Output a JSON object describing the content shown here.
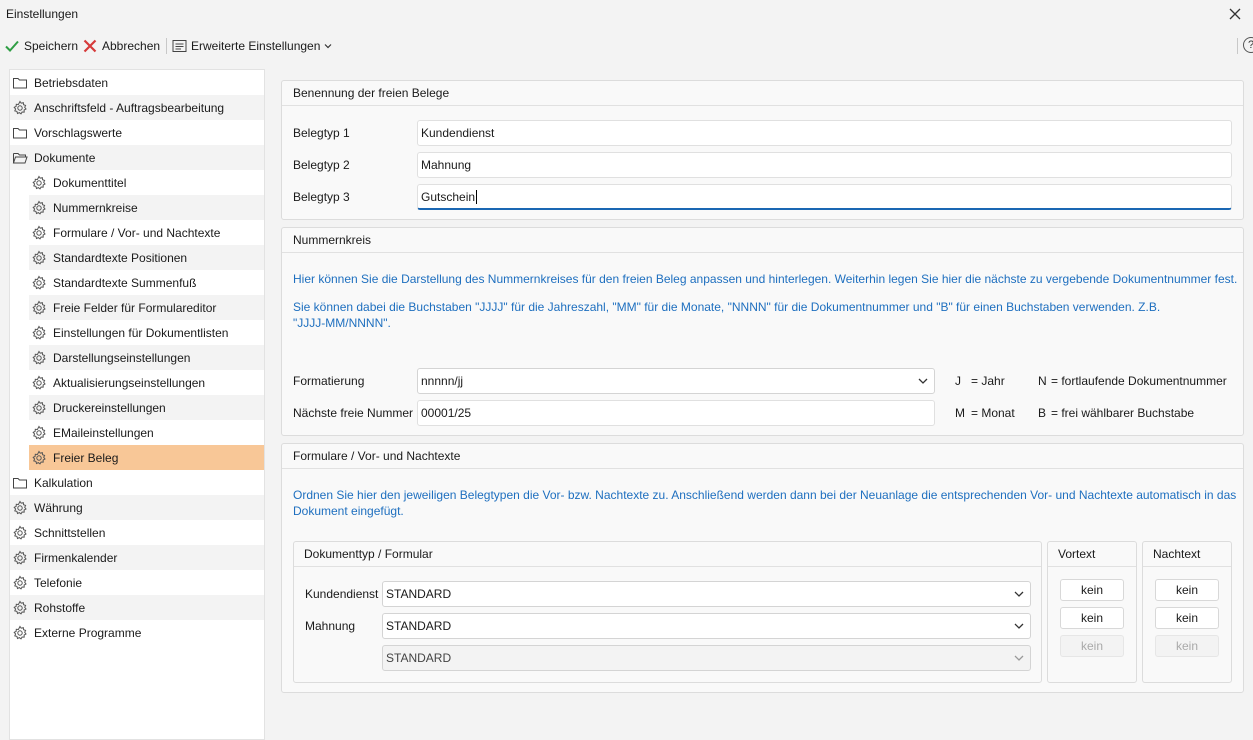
{
  "window": {
    "title": "Einstellungen"
  },
  "toolbar": {
    "save_label": "Speichern",
    "cancel_label": "Abbrechen",
    "advanced_label": "Erweiterte Einstellungen",
    "help_glyph": "?"
  },
  "sidebar": {
    "items": [
      {
        "label": "Betriebsdaten",
        "icon": "folder-icon"
      },
      {
        "label": "Anschriftsfeld - Auftragsbearbeitung",
        "icon": "gear-icon"
      },
      {
        "label": "Vorschlagswerte",
        "icon": "folder-icon"
      },
      {
        "label": "Dokumente",
        "icon": "folder-open-icon"
      },
      {
        "label": "Dokumenttitel",
        "icon": "gear-icon"
      },
      {
        "label": "Nummernkreise",
        "icon": "gear-icon"
      },
      {
        "label": "Formulare / Vor- und Nachtexte",
        "icon": "gear-icon"
      },
      {
        "label": "Standardtexte Positionen",
        "icon": "gear-icon"
      },
      {
        "label": "Standardtexte Summenfuß",
        "icon": "gear-icon"
      },
      {
        "label": "Freie Felder für Formulareditor",
        "icon": "gear-icon"
      },
      {
        "label": "Einstellungen für Dokumentlisten",
        "icon": "gear-icon"
      },
      {
        "label": "Darstellungseinstellungen",
        "icon": "gear-icon"
      },
      {
        "label": "Aktualisierungseinstellungen",
        "icon": "gear-icon"
      },
      {
        "label": "Druckereinstellungen",
        "icon": "gear-icon"
      },
      {
        "label": "EMaileinstellungen",
        "icon": "gear-icon"
      },
      {
        "label": "Freier Beleg",
        "icon": "gear-icon"
      },
      {
        "label": "Kalkulation",
        "icon": "folder-icon"
      },
      {
        "label": "Währung",
        "icon": "gear-icon"
      },
      {
        "label": "Schnittstellen",
        "icon": "gear-icon"
      },
      {
        "label": "Firmenkalender",
        "icon": "gear-icon"
      },
      {
        "label": "Telefonie",
        "icon": "gear-icon"
      },
      {
        "label": "Rohstoffe",
        "icon": "gear-icon"
      },
      {
        "label": "Externe Programme",
        "icon": "gear-icon"
      }
    ],
    "selected": "Freier Beleg"
  },
  "naming": {
    "header": "Benennung der freien Belege",
    "rows": [
      {
        "label": "Belegtyp 1",
        "value": "Kundendienst"
      },
      {
        "label": "Belegtyp 2",
        "value": "Mahnung"
      },
      {
        "label": "Belegtyp 3",
        "value": "Gutschein"
      }
    ]
  },
  "number_range": {
    "header": "Nummernkreis",
    "info1": "Hier können Sie die Darstellung des Nummernkreises für den freien Beleg anpassen und hinterlegen. Weiterhin legen Sie hier die nächste zu vergebende Dokumentnummer fest.",
    "info2": "Sie können dabei die Buchstaben \"JJJJ\" für die Jahreszahl, \"MM\" für die Monate, \"NNNN\" für die Dokumentnummer und \"B\" für einen Buchstaben verwenden. Z.B. \"JJJJ-MM/NNNN\".",
    "format_label": "Formatierung",
    "format_value": "nnnnn/jj",
    "next_label": "Nächste freie Nummer",
    "next_value": "00001/25",
    "legend": {
      "j_key": "J",
      "j_text": "= Jahr",
      "n_key": "N",
      "n_text": "= fortlaufende Dokumentnummer",
      "m_key": "M",
      "m_text": "= Monat",
      "b_key": "B",
      "b_text": "= frei wählbarer Buchstabe"
    }
  },
  "forms": {
    "header": "Formulare / Vor- und Nachtexte",
    "info": "Ordnen Sie hier den jeweiligen Belegtypen die Vor- bzw. Nachtexte zu. Anschließend werden dann bei der Neuanlage die entsprechenden Vor- und Nachtexte automatisch in das Dokument eingefügt.",
    "doc_header": "Dokumenttyp / Formular",
    "pre_header": "Vortext",
    "post_header": "Nachtext",
    "rows": [
      {
        "label": "Kundendienst",
        "form": "STANDARD",
        "pre": "kein",
        "post": "kein",
        "enabled": true
      },
      {
        "label": "Mahnung",
        "form": "STANDARD",
        "pre": "kein",
        "post": "kein",
        "enabled": true
      },
      {
        "label": "",
        "form": "STANDARD",
        "pre": "kein",
        "post": "kein",
        "enabled": false
      }
    ]
  }
}
